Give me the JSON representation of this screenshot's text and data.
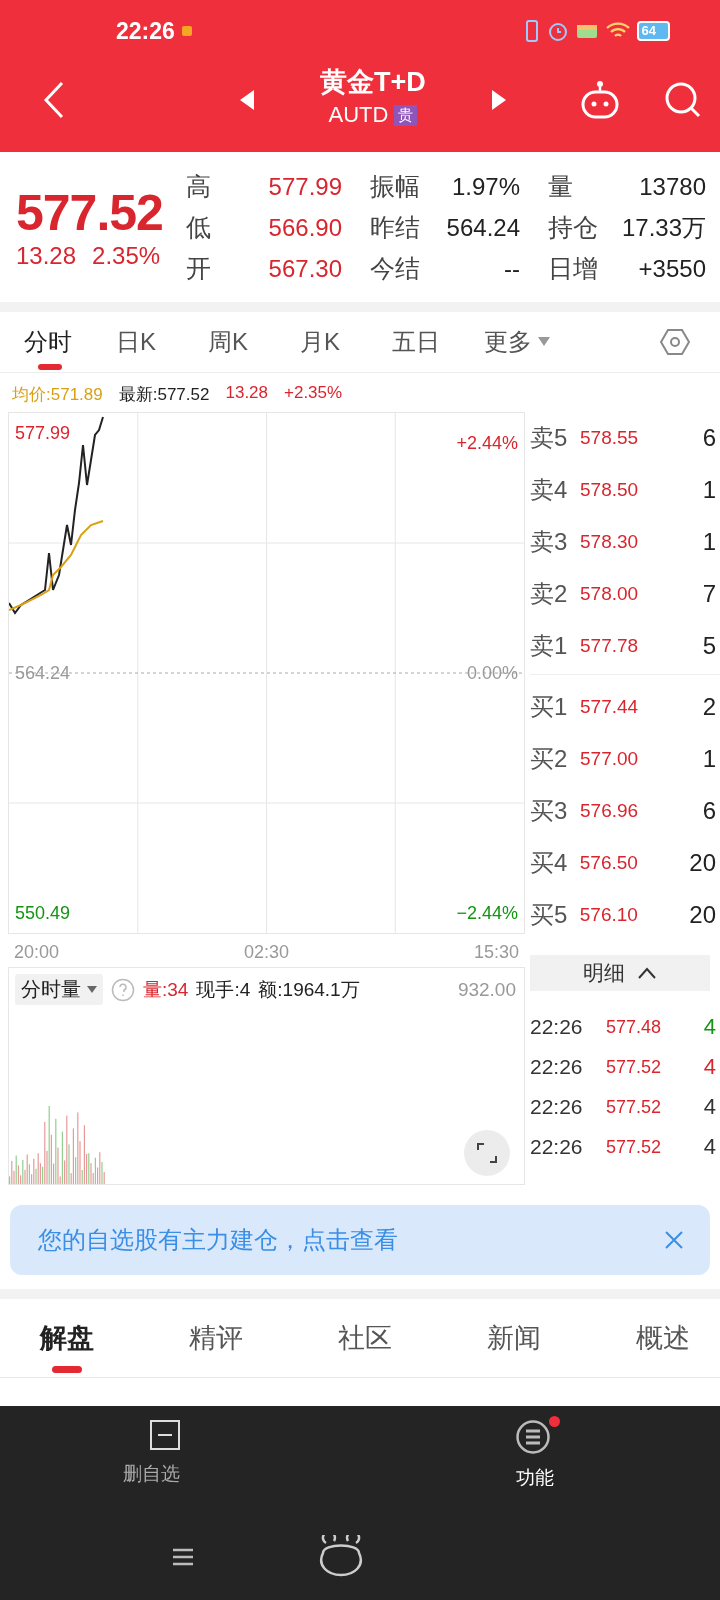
{
  "status_bar": {
    "time": "22:26",
    "battery": "64"
  },
  "header": {
    "title": "黄金T+D",
    "code": "AUTD",
    "badge": "贵"
  },
  "quote": {
    "price": "577.52",
    "change": "13.28",
    "change_pct": "2.35%",
    "stats": [
      {
        "label": "高",
        "value": "577.99",
        "color": "#d9252e"
      },
      {
        "label": "振幅",
        "value": "1.97%",
        "color": "#222222"
      },
      {
        "label": "量",
        "value": "13780",
        "color": "#222222"
      },
      {
        "label": "低",
        "value": "566.90",
        "color": "#d9252e"
      },
      {
        "label": "昨结",
        "value": "564.24",
        "color": "#222222"
      },
      {
        "label": "持仓",
        "value": "17.33万",
        "color": "#222222"
      },
      {
        "label": "开",
        "value": "567.30",
        "color": "#d9252e"
      },
      {
        "label": "今结",
        "value": "--",
        "color": "#222222"
      },
      {
        "label": "日增",
        "value": "+3550",
        "color": "#222222"
      }
    ]
  },
  "chart_tabs": [
    {
      "label": "分时",
      "selected": true
    },
    {
      "label": "日K",
      "selected": false
    },
    {
      "label": "周K",
      "selected": false
    },
    {
      "label": "月K",
      "selected": false
    },
    {
      "label": "五日",
      "selected": false
    },
    {
      "label": "更多",
      "selected": false,
      "dropdown": true
    }
  ],
  "info_line": {
    "avg": "均价:571.89",
    "latest": "最新:577.52",
    "change": "13.28",
    "change_pct": "+2.35%"
  },
  "price_chart": {
    "top_label": "577.99",
    "mid_label": "564.24",
    "bottom_label": "550.49",
    "top_pct": "+2.44%",
    "mid_pct": "0.00%",
    "bottom_pct": "−2.44%",
    "time_labels": [
      "20:00",
      "02:30",
      "15:30"
    ]
  },
  "order_book": {
    "asks": [
      {
        "label": "卖5",
        "price": "578.55",
        "qty": "6"
      },
      {
        "label": "卖4",
        "price": "578.50",
        "qty": "1"
      },
      {
        "label": "卖3",
        "price": "578.30",
        "qty": "1"
      },
      {
        "label": "卖2",
        "price": "578.00",
        "qty": "7"
      },
      {
        "label": "卖1",
        "price": "577.78",
        "qty": "5"
      }
    ],
    "bids": [
      {
        "label": "买1",
        "price": "577.44",
        "qty": "2"
      },
      {
        "label": "买2",
        "price": "577.00",
        "qty": "1"
      },
      {
        "label": "买3",
        "price": "576.96",
        "qty": "6"
      },
      {
        "label": "买4",
        "price": "576.50",
        "qty": "20"
      },
      {
        "label": "买5",
        "price": "576.10",
        "qty": "20"
      }
    ]
  },
  "volume": {
    "selector": "分时量",
    "vol": "量:34",
    "hand": "现手:4",
    "amount": "额:1964.1万",
    "max": "932.00"
  },
  "trades": {
    "header": "明细",
    "rows": [
      {
        "time": "22:26",
        "price": "577.48",
        "qty": "4",
        "color": "#139413"
      },
      {
        "time": "22:26",
        "price": "577.52",
        "qty": "4",
        "color": "#d9252e"
      },
      {
        "time": "22:26",
        "price": "577.52",
        "qty": "4",
        "color": "#333333"
      },
      {
        "time": "22:26",
        "price": "577.52",
        "qty": "4",
        "color": "#333333"
      }
    ]
  },
  "banner": {
    "text": "您的自选股有主力建仓，点击查看"
  },
  "content_tabs": [
    {
      "label": "解盘",
      "selected": true
    },
    {
      "label": "精评",
      "selected": false
    },
    {
      "label": "社区",
      "selected": false
    },
    {
      "label": "新闻",
      "selected": false
    },
    {
      "label": "概述",
      "selected": false
    }
  ],
  "bottom_bar": [
    {
      "kind": "remove",
      "label": "删自选",
      "badge": false
    },
    {
      "kind": "menu",
      "label": "功能",
      "badge": true
    }
  ]
}
